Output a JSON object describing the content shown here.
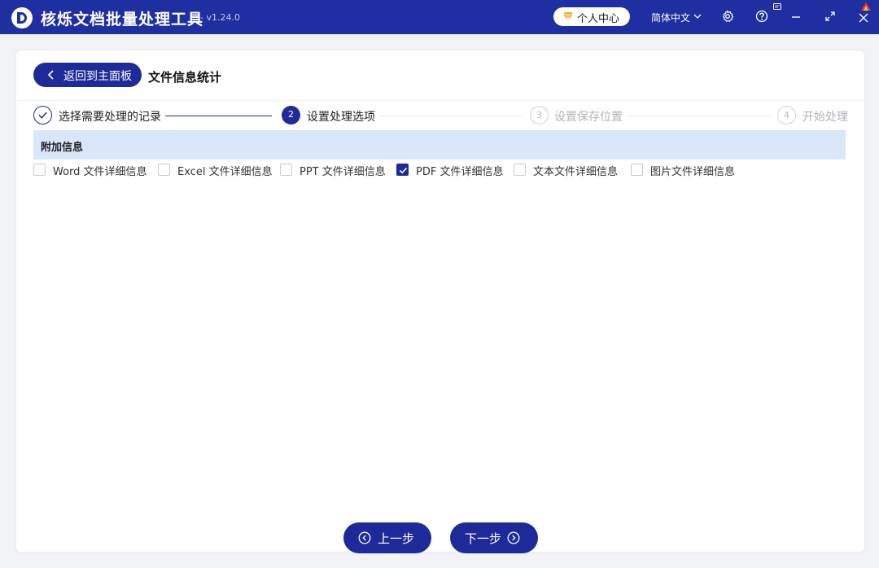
{
  "app": {
    "title": "核烁文档批量处理工具",
    "version": "- v1.24.0",
    "user_center": "个人中心",
    "language": "简体中文"
  },
  "header": {
    "back_label": "返回到主面板",
    "section_title": "文件信息统计"
  },
  "steps": [
    {
      "number": "",
      "label": "选择需要处理的记录",
      "state": "done"
    },
    {
      "number": "2",
      "label": "设置处理选项",
      "state": "active"
    },
    {
      "number": "3",
      "label": "设置保存位置",
      "state": "pending"
    },
    {
      "number": "4",
      "label": "开始处理",
      "state": "pending"
    }
  ],
  "attachment": {
    "title": "附加信息",
    "options": [
      {
        "label": "Word 文件详细信息",
        "checked": false
      },
      {
        "label": "Excel 文件详细信息",
        "checked": false
      },
      {
        "label": "PPT 文件详细信息",
        "checked": false
      },
      {
        "label": "PDF 文件详细信息",
        "checked": true
      },
      {
        "label": "文本文件详细信息",
        "checked": false
      },
      {
        "label": "图片文件详细信息",
        "checked": false
      }
    ]
  },
  "footer": {
    "prev_label": "上一步",
    "next_label": "下一步"
  },
  "colors": {
    "brand": "#1f2ea0",
    "button": "#1f2a9a",
    "info_bar": "#d9e7fb",
    "pending": "#c7c9cf"
  }
}
